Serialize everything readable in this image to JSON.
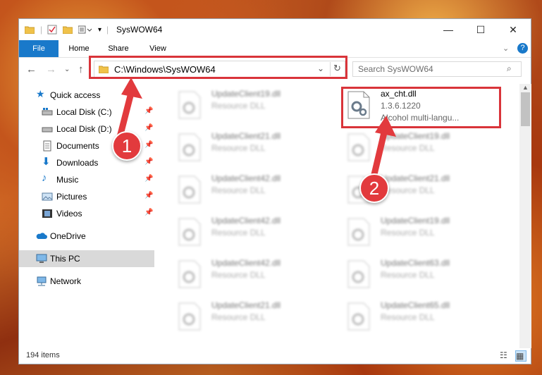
{
  "window": {
    "title": "SysWOW64"
  },
  "ribbon": {
    "tabs": [
      "File",
      "Home",
      "Share",
      "View"
    ]
  },
  "address": {
    "path": "C:\\Windows\\SysWOW64"
  },
  "search": {
    "placeholder": "Search SysWOW64"
  },
  "nav": {
    "items": [
      {
        "label": "Quick access"
      },
      {
        "label": "Local Disk (C:)"
      },
      {
        "label": "Local Disk (D:)"
      },
      {
        "label": "Documents"
      },
      {
        "label": "Downloads"
      },
      {
        "label": "Music"
      },
      {
        "label": "Pictures"
      },
      {
        "label": "Videos"
      },
      {
        "label": "OneDrive"
      },
      {
        "label": "This PC"
      },
      {
        "label": "Network"
      }
    ]
  },
  "files": {
    "left": [
      {
        "name": "UpdateClient19.dll",
        "type": "Resource DLL"
      },
      {
        "name": "UpdateClient21.dll",
        "type": "Resource DLL"
      },
      {
        "name": "UpdateClient42.dll",
        "type": "Resource DLL"
      },
      {
        "name": "UpdateClient42.dll",
        "type": "Resource DLL"
      },
      {
        "name": "UpdateClient42.dll",
        "type": "Resource DLL"
      },
      {
        "name": "UpdateClient21.dll",
        "type": "Resource DLL"
      }
    ],
    "highlighted": {
      "name": "ax_cht.dll",
      "version": "1.3.6.1220",
      "description": "Alcohol multi-langu..."
    },
    "right": [
      {
        "name": "UpdateClient19.dll",
        "type": "Resource DLL"
      },
      {
        "name": "UpdateClient21.dll",
        "type": "Resource DLL"
      },
      {
        "name": "UpdateClient19.dll",
        "type": "Resource DLL"
      },
      {
        "name": "UpdateClient63.dll",
        "type": "Resource DLL"
      },
      {
        "name": "UpdateClient65.dll",
        "type": "Resource DLL"
      }
    ]
  },
  "status": {
    "items": "194 items"
  },
  "callouts": {
    "one": "1",
    "two": "2"
  },
  "colors": {
    "accent": "#1979ca",
    "highlight": "#d9343a"
  }
}
